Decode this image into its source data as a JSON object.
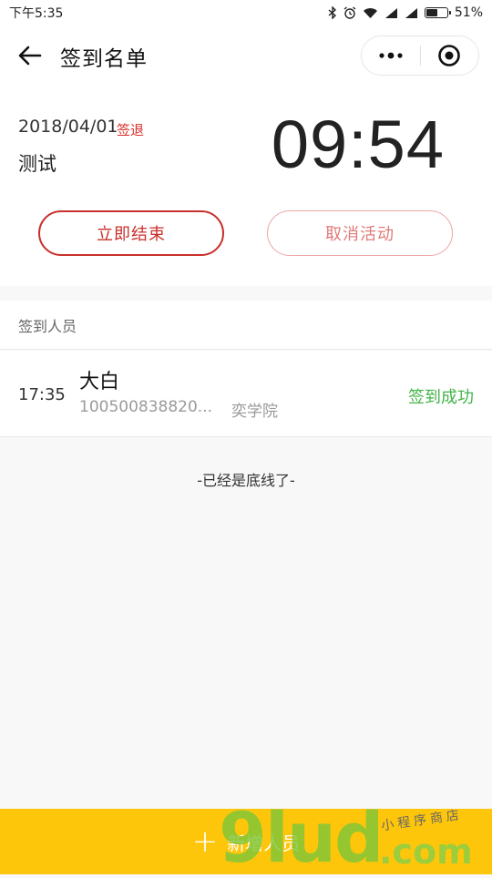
{
  "status_bar": {
    "time": "下午5:35",
    "battery_text": "51%",
    "battery_level": 0.51,
    "icons": [
      "bluetooth-icon",
      "alarm-icon",
      "wifi-icon",
      "signal-icon",
      "signal-icon",
      "battery-icon"
    ]
  },
  "nav": {
    "title": "签到名单",
    "back_icon": "arrow-left-icon",
    "more_icon": "more-dots-icon",
    "close_icon": "target-circle-icon"
  },
  "event": {
    "date": "2018/04/01",
    "tag": "签退",
    "name": "测试",
    "countdown": "09:54",
    "end_button": "立即结束",
    "cancel_button": "取消活动"
  },
  "attendees": {
    "section_title": "签到人员",
    "items": [
      {
        "time": "17:35",
        "name": "大白",
        "id": "100500838820...",
        "school": "奕学院",
        "status": "签到成功"
      }
    ],
    "end_text": "-已经是底线了-"
  },
  "add_button": {
    "label": "新增人员",
    "icon": "plus-icon"
  },
  "watermark": {
    "main": "9lud",
    "domain": ".com",
    "slogan": "小程序商店"
  },
  "colors": {
    "accent_red": "#c9302c",
    "cancel_red": "#e07a7a",
    "success_green": "#43b347",
    "add_bar_yellow": "#fec60b"
  }
}
